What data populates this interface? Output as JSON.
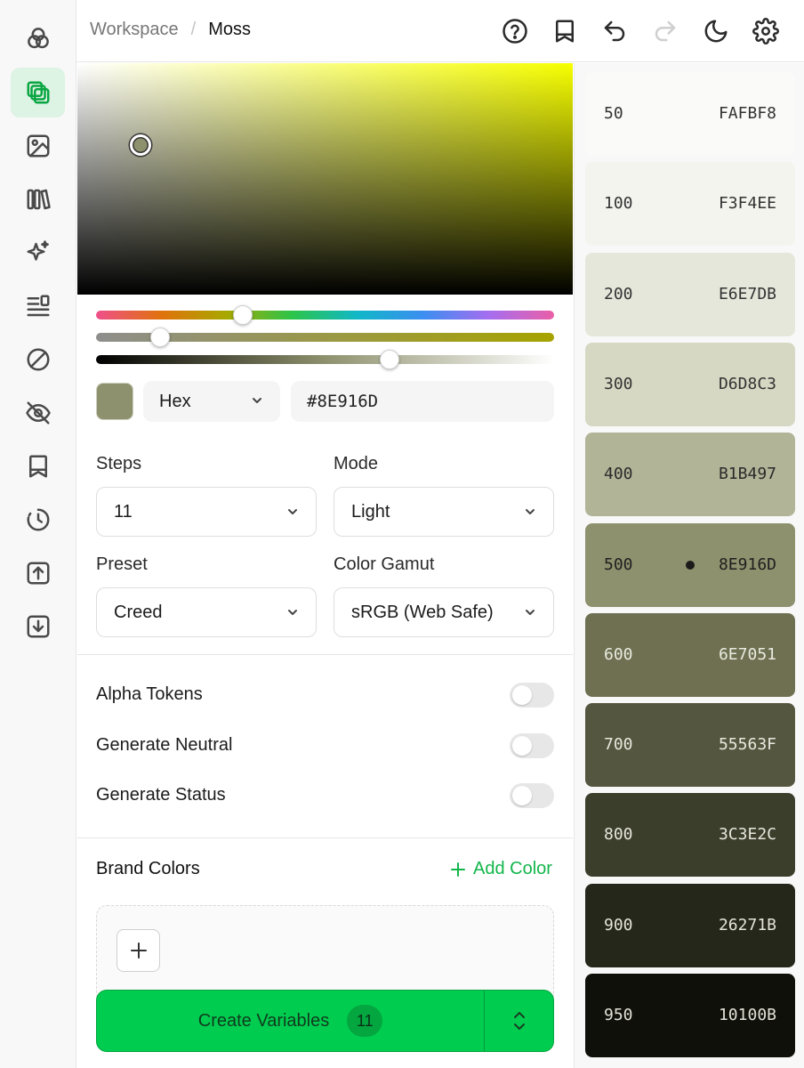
{
  "breadcrumb": {
    "workspace": "Workspace",
    "separator": "/",
    "current": "Moss"
  },
  "picker": {
    "current_hex": "#8E916D",
    "format": "Hex",
    "hue_position": 0.32,
    "saturation_position": 0.14,
    "lightness_position": 0.64
  },
  "steps": {
    "label": "Steps",
    "value": "11"
  },
  "mode": {
    "label": "Mode",
    "value": "Light"
  },
  "preset": {
    "label": "Preset",
    "value": "Creed"
  },
  "gamut": {
    "label": "Color Gamut",
    "value": "sRGB (Web Safe)"
  },
  "toggles": [
    {
      "label": "Alpha Tokens",
      "on": false
    },
    {
      "label": "Generate Neutral",
      "on": false
    },
    {
      "label": "Generate Status",
      "on": false
    }
  ],
  "brand": {
    "title": "Brand Colors",
    "add_label": "Add Color"
  },
  "create": {
    "label": "Create Variables",
    "count": "11"
  },
  "palette": [
    {
      "step": "50",
      "hex": "FAFBF8",
      "bg": "#FAFBF8",
      "fg": "#333333",
      "selected": false
    },
    {
      "step": "100",
      "hex": "F3F4EE",
      "bg": "#F3F4EE",
      "fg": "#333333",
      "selected": false
    },
    {
      "step": "200",
      "hex": "E6E7DB",
      "bg": "#E6E7DB",
      "fg": "#333333",
      "selected": false
    },
    {
      "step": "300",
      "hex": "D6D8C3",
      "bg": "#D6D8C3",
      "fg": "#333333",
      "selected": false
    },
    {
      "step": "400",
      "hex": "B1B497",
      "bg": "#B1B497",
      "fg": "#2a2a2a",
      "selected": false
    },
    {
      "step": "500",
      "hex": "8E916D",
      "bg": "#8E916D",
      "fg": "#1f1f1f",
      "selected": true
    },
    {
      "step": "600",
      "hex": "6E7051",
      "bg": "#6E7051",
      "fg": "#eaeae0",
      "selected": false
    },
    {
      "step": "700",
      "hex": "55563F",
      "bg": "#55563F",
      "fg": "#e8e8de",
      "selected": false
    },
    {
      "step": "800",
      "hex": "3C3E2C",
      "bg": "#3C3E2C",
      "fg": "#e6e6dc",
      "selected": false
    },
    {
      "step": "900",
      "hex": "26271B",
      "bg": "#26271B",
      "fg": "#e4e4da",
      "selected": false
    },
    {
      "step": "950",
      "hex": "10100B",
      "bg": "#10100B",
      "fg": "#e2e2d8",
      "selected": false
    }
  ],
  "colors": {
    "accent": "#00CD4F",
    "accent_text": "#12B64B",
    "sidebar_active": "#DDF3E3"
  },
  "icons": {
    "sidebar": [
      "palette-icon",
      "layers-icon",
      "image-icon",
      "library-icon",
      "sparkles-icon",
      "list-icon",
      "ban-icon",
      "eye-off-icon",
      "bookmark-icon",
      "history-icon",
      "upload-icon",
      "download-icon"
    ],
    "header": [
      "help-icon",
      "bookmark-icon",
      "undo-icon",
      "redo-icon",
      "moon-icon",
      "settings-icon"
    ]
  }
}
